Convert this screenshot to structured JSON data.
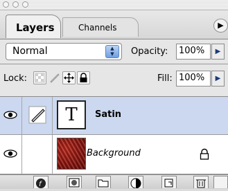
{
  "tabs": [
    {
      "label": "Layers",
      "active": true
    },
    {
      "label": "Channels",
      "active": false
    }
  ],
  "blend_mode": {
    "value": "Normal"
  },
  "opacity": {
    "label": "Opacity:",
    "value": "100%"
  },
  "lock": {
    "label": "Lock:"
  },
  "fill": {
    "label": "Fill:",
    "value": "100%"
  },
  "layers": [
    {
      "name": "Satin",
      "thumbnail_text": "T",
      "selected": true,
      "visible": true
    },
    {
      "name": "Background",
      "selected": false,
      "visible": true,
      "locked": true
    }
  ],
  "colors": {
    "selected_row": "#cbd8f0",
    "accent": "#6f9fe0",
    "background_thumb": "#a51d14"
  },
  "icons": [
    "eye-icon",
    "brush-icon",
    "lock-icon",
    "move-icon",
    "transparency-lock-icon",
    "layer-style-icon",
    "layer-mask-icon",
    "folder-icon",
    "adjustment-layer-icon",
    "new-layer-icon",
    "trash-icon",
    "panel-menu-icon"
  ]
}
